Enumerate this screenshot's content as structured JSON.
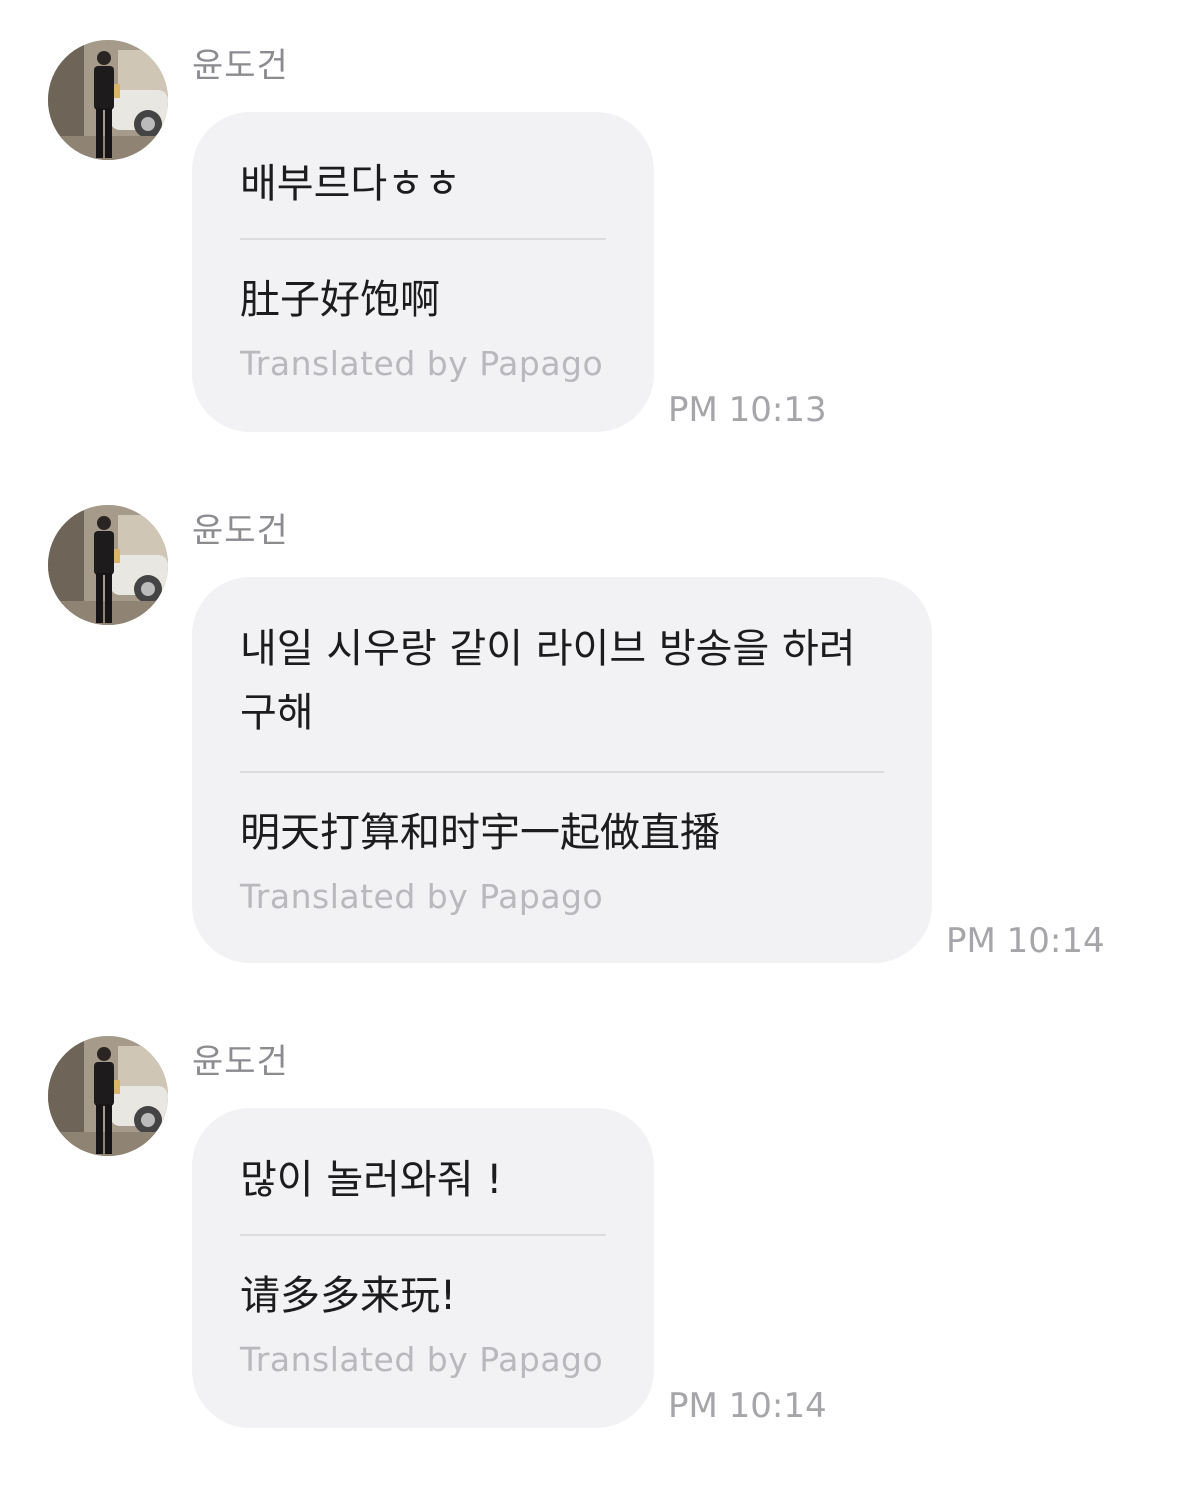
{
  "messages": [
    {
      "sender": "윤도건",
      "original": "배부르다ㅎㅎ",
      "translated": "肚子好饱啊",
      "credit": "Translated by Papago",
      "time": "PM 10:13"
    },
    {
      "sender": "윤도건",
      "original": "내일 시우랑 같이 라이브 방송을 하려구해",
      "translated": "明天打算和时宇一起做直播",
      "credit": "Translated by Papago",
      "time": "PM 10:14"
    },
    {
      "sender": "윤도건",
      "original": "많이 놀러와줘 !",
      "translated": "请多多来玩!",
      "credit": "Translated by Papago",
      "time": "PM 10:14"
    }
  ]
}
